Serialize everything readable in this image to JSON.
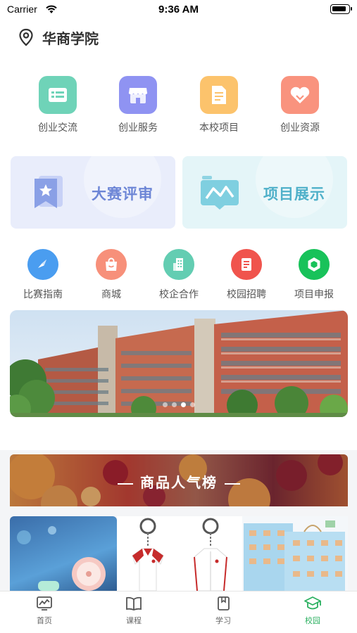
{
  "status_bar": {
    "carrier": "Carrier",
    "time": "9:36 AM"
  },
  "location": {
    "name": "华商学院"
  },
  "quick_actions": [
    {
      "label": "创业交流",
      "icon": "card-list-icon",
      "color": "#6fd3b8"
    },
    {
      "label": "创业服务",
      "icon": "shop-icon",
      "color": "#8f93f2"
    },
    {
      "label": "本校项目",
      "icon": "document-icon",
      "color": "#fcc36c"
    },
    {
      "label": "创业资源",
      "icon": "heart-tag-icon",
      "color": "#f9937e"
    }
  ],
  "feature_banners": [
    {
      "label": "大赛评审",
      "icon": "star-bookmark-icon"
    },
    {
      "label": "项目展示",
      "icon": "chart-board-icon"
    }
  ],
  "shortcuts": [
    {
      "label": "比赛指南",
      "icon": "compass-icon",
      "color": "#4a9df0"
    },
    {
      "label": "商城",
      "icon": "shopping-bag-icon",
      "color": "#f7907a"
    },
    {
      "label": "校企合作",
      "icon": "building-icon",
      "color": "#63cdb2"
    },
    {
      "label": "校园招聘",
      "icon": "recruit-doc-icon",
      "color": "#f0544d"
    },
    {
      "label": "项目申报",
      "icon": "hexagon-icon",
      "color": "#18c25a"
    }
  ],
  "carousel": {
    "slide_count": 4,
    "active_slide": 3
  },
  "popular": {
    "title": "商品人气榜"
  },
  "tabbar": [
    {
      "label": "首页",
      "icon": "chart-screen-icon",
      "active": false
    },
    {
      "label": "课程",
      "icon": "book-icon",
      "active": false
    },
    {
      "label": "学习",
      "icon": "notebook-icon",
      "active": false
    },
    {
      "label": "校园",
      "icon": "graduation-cap-icon",
      "active": true
    }
  ],
  "colors": {
    "accent": "#2bb060",
    "banner_left_text": "#6d86d6",
    "banner_right_text": "#4fb0c9"
  }
}
